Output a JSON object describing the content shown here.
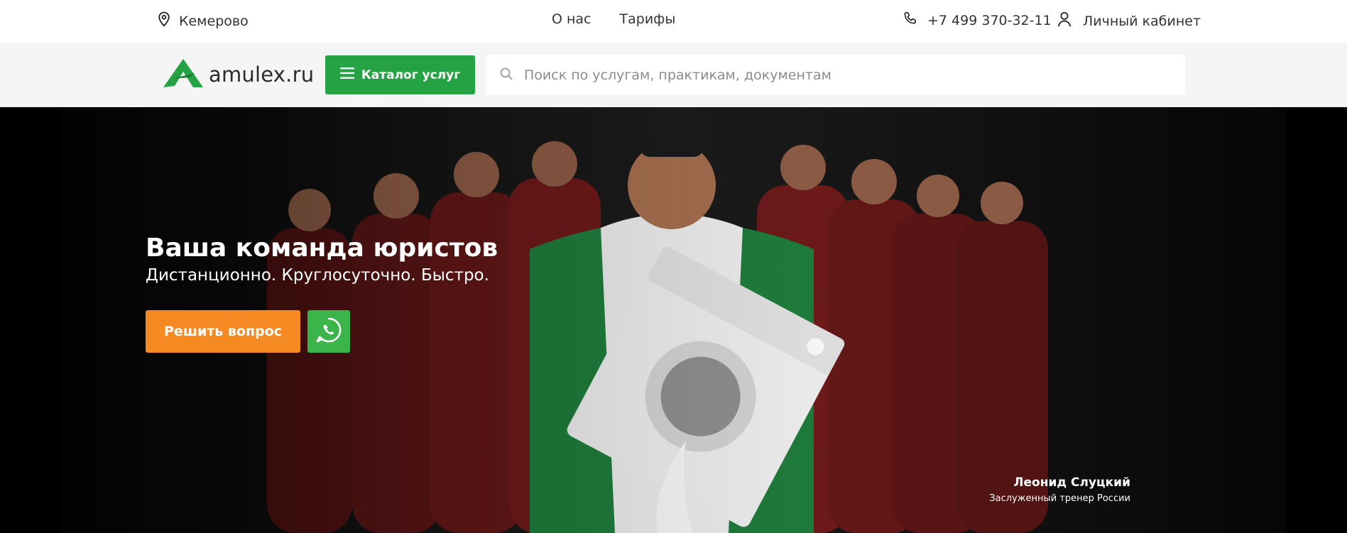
{
  "topbar": {
    "city": "Кемерово",
    "nav": [
      "О нас",
      "Тарифы"
    ],
    "phone": "+7 499 370-32-11",
    "account": "Личный кабинет"
  },
  "header": {
    "logo_text": "amulex.ru",
    "catalog_label": "Каталог услуг",
    "search_placeholder": "Поиск по услугам, практикам, документам",
    "search_value": ""
  },
  "hero": {
    "title": "Ваша команда юристов",
    "subtitle": "Дистанционно. Круглосуточно. Быстро.",
    "cta_label": "Решить вопрос",
    "caption_name": "Леонид Слуцкий",
    "caption_role": "Заслуженный тренер России"
  },
  "colors": {
    "brand_green": "#25a244",
    "cta_orange": "#f58a23",
    "whatsapp_green": "#3bb44a",
    "header_bg": "#f5f5f5"
  },
  "icons": [
    "location-pin-icon",
    "phone-icon",
    "user-icon",
    "logo-mark-icon",
    "menu-icon",
    "search-icon",
    "whatsapp-icon"
  ]
}
